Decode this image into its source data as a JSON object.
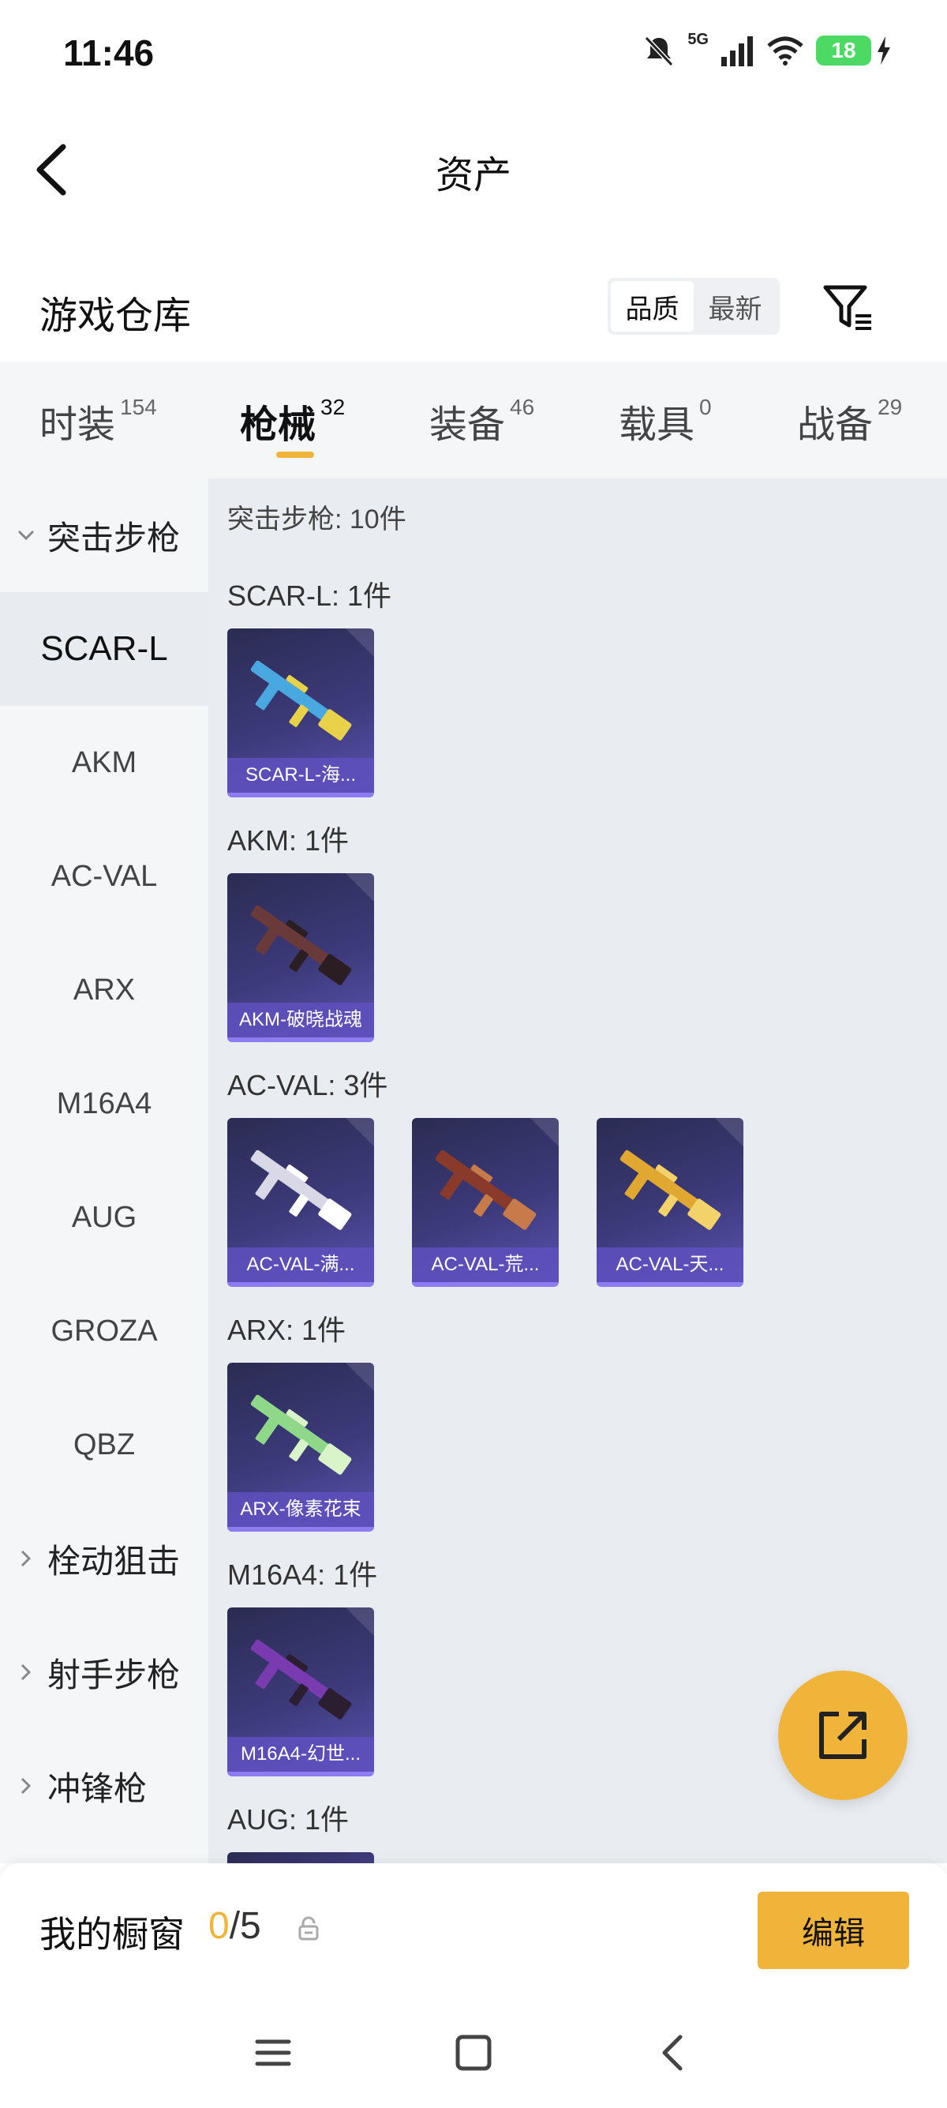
{
  "status_bar": {
    "time": "11:46",
    "network": "5G",
    "battery": "18"
  },
  "nav": {
    "title": "资产"
  },
  "warehouse": {
    "title": "游戏仓库",
    "sort_options": [
      {
        "label": "品质",
        "active": true
      },
      {
        "label": "最新",
        "active": false
      }
    ]
  },
  "tabs": [
    {
      "label": "时装",
      "count": "154"
    },
    {
      "label": "枪械",
      "count": "32",
      "active": true
    },
    {
      "label": "装备",
      "count": "46"
    },
    {
      "label": "载具",
      "count": "0"
    },
    {
      "label": "战备",
      "count": "29"
    }
  ],
  "sidebar": {
    "items": [
      {
        "label": "突击步枪",
        "type": "group",
        "expanded": true
      },
      {
        "label": "SCAR-L",
        "type": "item",
        "active": true
      },
      {
        "label": "AKM",
        "type": "item"
      },
      {
        "label": "AC-VAL",
        "type": "item"
      },
      {
        "label": "ARX",
        "type": "item"
      },
      {
        "label": "M16A4",
        "type": "item"
      },
      {
        "label": "AUG",
        "type": "item"
      },
      {
        "label": "GROZA",
        "type": "item"
      },
      {
        "label": "QBZ",
        "type": "item"
      },
      {
        "label": "栓动狙击",
        "type": "group",
        "expanded": false
      },
      {
        "label": "射手步枪",
        "type": "group",
        "expanded": false
      },
      {
        "label": "冲锋枪",
        "type": "group",
        "expanded": false
      }
    ]
  },
  "content": {
    "category_header": "突击步枪: 10件",
    "groups": [
      {
        "label": "SCAR-L: 1件",
        "items": [
          {
            "name": "SCAR-L-海...",
            "gun_color": "#4aa8e0",
            "accent": "#e8d24a"
          }
        ]
      },
      {
        "label": "AKM: 1件",
        "items": [
          {
            "name": "AKM-破晓战魂",
            "gun_color": "#6a3a3a",
            "accent": "#2a1e22"
          }
        ]
      },
      {
        "label": "AC-VAL: 3件",
        "items": [
          {
            "name": "AC-VAL-满...",
            "gun_color": "#d8d8e6",
            "accent": "#ffffff"
          },
          {
            "name": "AC-VAL-荒...",
            "gun_color": "#8a3a2a",
            "accent": "#c77a4a"
          },
          {
            "name": "AC-VAL-天...",
            "gun_color": "#e0a830",
            "accent": "#f4d26a"
          }
        ]
      },
      {
        "label": "ARX: 1件",
        "items": [
          {
            "name": "ARX-像素花束",
            "gun_color": "#8fd88a",
            "accent": "#d8f4c8"
          }
        ]
      },
      {
        "label": "M16A4: 1件",
        "items": [
          {
            "name": "M16A4-幻世...",
            "gun_color": "#7a3ab0",
            "accent": "#2a1e30"
          }
        ]
      },
      {
        "label": "AUG: 1件",
        "items": []
      }
    ]
  },
  "bottom_bar": {
    "showcase_label": "我的橱窗",
    "showcase_current": "0",
    "showcase_max": "/5",
    "edit_label": "编辑"
  },
  "colors": {
    "accent": "#f0b43a",
    "card_bg": "#3c3a7a"
  }
}
